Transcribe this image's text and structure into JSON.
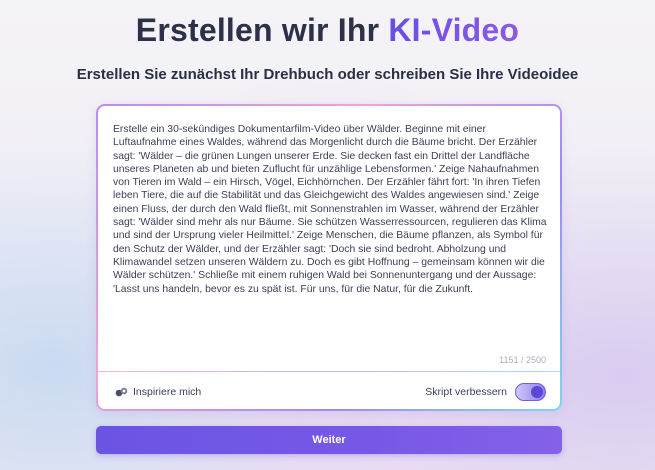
{
  "header": {
    "title_main": "Erstellen wir Ihr ",
    "title_accent": "KI-Video",
    "subtitle": "Erstellen Sie zunächst Ihr Drehbuch oder schreiben Sie Ihre Videoidee"
  },
  "editor": {
    "script_text": "Erstelle ein 30-sekündiges Dokumentarfilm-Video über Wälder. Beginne mit einer Luftaufnahme eines Waldes, während das Morgenlicht durch die Bäume bricht. Der Erzähler sagt: 'Wälder – die grünen Lungen unserer Erde. Sie decken fast ein Drittel der Landfläche unseres Planeten ab und bieten Zuflucht für unzählige Lebensformen.' Zeige Nahaufnahmen von Tieren im Wald – ein Hirsch, Vögel, Eichhörnchen. Der Erzähler fährt fort: 'In ihren Tiefen leben Tiere, die auf die Stabilität und das Gleichgewicht des Waldes angewiesen sind.' Zeige einen Fluss, der durch den Wald fließt, mit Sonnenstrahlen im Wasser, während der Erzähler sagt: 'Wälder sind mehr als nur Bäume. Sie schützen Wasserressourcen, regulieren das Klima und sind der Ursprung vieler Heilmittel.' Zeige Menschen, die Bäume pflanzen, als Symbol für den Schutz der Wälder, und der Erzähler sagt: 'Doch sie sind bedroht. Abholzung und Klimawandel setzen unseren Wäldern zu. Doch es gibt Hoffnung – gemeinsam können wir die Wälder schützen.' Schließe mit einem ruhigen Wald bei Sonnenuntergang und der Aussage: 'Lasst uns handeln, bevor es zu spät ist. Für uns, für die Natur, für die Zukunft.",
    "char_count": "1151 / 2500"
  },
  "toolbar": {
    "inspire_label": "Inspiriere mich",
    "inspire_icon": "sparkle-bubbles-icon",
    "improve_label": "Skript verbessern",
    "improve_enabled": true
  },
  "actions": {
    "continue_label": "Weiter"
  },
  "colors": {
    "accent": "#6b4ce6",
    "button": "#7359e4",
    "title_text": "#2c3148"
  }
}
